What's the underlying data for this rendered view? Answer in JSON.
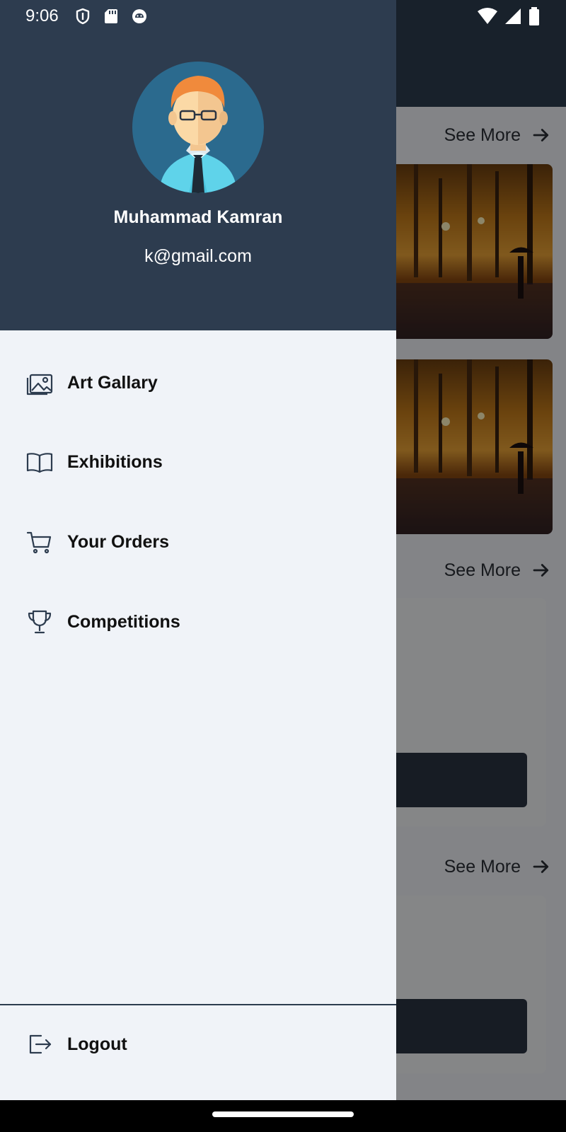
{
  "status_bar": {
    "time": "9:06",
    "left_icons": [
      "shield-icon",
      "sd-card-icon",
      "android-debug-icon"
    ],
    "right_icons": [
      "wifi-icon",
      "signal-icon",
      "battery-icon"
    ]
  },
  "drawer": {
    "user": {
      "name": "Muhammad Kamran",
      "email": "k@gmail.com",
      "avatar": "avatar-man-glasses"
    },
    "items": [
      {
        "label": "Art Gallary",
        "icon": "image-gallery-icon"
      },
      {
        "label": "Exhibitions",
        "icon": "open-book-icon"
      },
      {
        "label": "Your Orders",
        "icon": "shopping-cart-icon"
      },
      {
        "label": "Competitions",
        "icon": "trophy-icon"
      }
    ],
    "logout": {
      "label": "Logout",
      "icon": "logout-icon"
    }
  },
  "background": {
    "see_more_label": "See More",
    "sections": 3,
    "art_images": 2
  },
  "colors": {
    "header": "#2d3c4f",
    "drawer_bg": "#f0f3f8",
    "text": "#111111",
    "scrim": "rgba(0,0,0,0.45)"
  }
}
